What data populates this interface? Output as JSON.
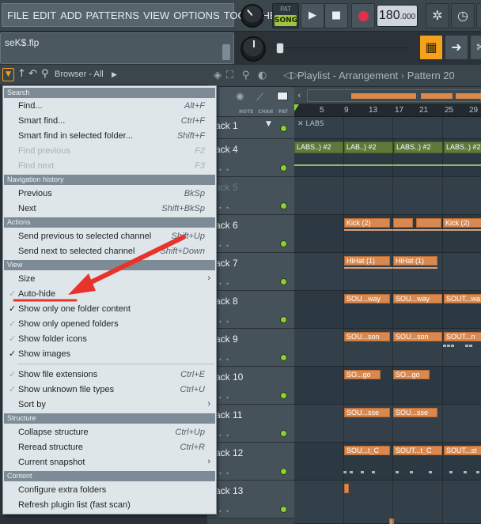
{
  "menubar": [
    "FILE",
    "EDIT",
    "ADD",
    "PATTERNS",
    "VIEW",
    "OPTIONS",
    "TOOLS",
    "HELP"
  ],
  "transport": {
    "pat_label": "PAT",
    "song_label": "SONG",
    "tempo_int": "180",
    "tempo_dec": ".000"
  },
  "hint": {
    "project": "seK$.flp"
  },
  "browser": {
    "title": "Browser - All"
  },
  "playlist": {
    "title": "Playlist - Arrangement",
    "pattern": "Pattern 20"
  },
  "tracklist": {
    "headers": [
      "NOTE",
      "CHAN",
      "PAT"
    ],
    "tracks": [
      "ack 1",
      "ack 4",
      "ack 5",
      "ack 6",
      "ack 7",
      "ack 8",
      "ack 9",
      "ack 10",
      "ack 11",
      "ack 12",
      "ack 13"
    ]
  },
  "ruler": [
    "5",
    "9",
    "13",
    "17",
    "21",
    "25",
    "29"
  ],
  "clips": {
    "labs_header": "LABS",
    "labs": [
      "LABS..) #2",
      "LAB..) #2",
      "LABS..) #2",
      "LABS..) #2"
    ],
    "kick": [
      "Kick (2)",
      "",
      "",
      "Kick (2)"
    ],
    "hihat": [
      "HiHat (1)",
      "HiHat (1)"
    ],
    "sou_way": [
      "SOU...way",
      "SOU...way",
      "SOUT...wa"
    ],
    "sou_son": [
      "SOU...son",
      "SOU...son",
      "SOUT...n"
    ],
    "so_go": [
      "SO...go",
      "SO...go"
    ],
    "sou_sse": [
      "SOU...sse",
      "SOU...sse"
    ],
    "sou_tc": [
      "SOU...t_C",
      "SOUT...t_C",
      "SOUT...st"
    ]
  },
  "menu": {
    "sections": {
      "search": "Search",
      "nav": "Navigation history",
      "actions": "Actions",
      "view": "View",
      "structure": "Structure",
      "content": "Content"
    },
    "search": [
      {
        "label": "Find...",
        "shortcut": "Alt+F"
      },
      {
        "label": "Smart find...",
        "shortcut": "Ctrl+F"
      },
      {
        "label": "Smart find in selected folder...",
        "shortcut": "Shift+F"
      },
      {
        "label": "Find previous",
        "shortcut": "F2"
      },
      {
        "label": "Find next",
        "shortcut": "F3"
      }
    ],
    "nav": [
      {
        "label": "Previous",
        "shortcut": "BkSp"
      },
      {
        "label": "Next",
        "shortcut": "Shift+BkSp"
      }
    ],
    "actions": [
      {
        "label": "Send previous to selected channel",
        "shortcut": "Shift+Up"
      },
      {
        "label": "Send next to selected channel",
        "shortcut": "Shift+Down"
      }
    ],
    "view": [
      {
        "label": "Size",
        "shortcut": ""
      },
      {
        "label": "Auto-hide",
        "shortcut": ""
      },
      {
        "label": "Show only one folder content",
        "shortcut": ""
      },
      {
        "label": "Show only opened folders",
        "shortcut": ""
      },
      {
        "label": "Show folder icons",
        "shortcut": ""
      },
      {
        "label": "Show images",
        "shortcut": ""
      },
      {
        "label": "Show file extensions",
        "shortcut": "Ctrl+E"
      },
      {
        "label": "Show unknown file types",
        "shortcut": "Ctrl+U"
      },
      {
        "label": "Sort by",
        "shortcut": ""
      }
    ],
    "structure": [
      {
        "label": "Collapse structure",
        "shortcut": "Ctrl+Up"
      },
      {
        "label": "Reread structure",
        "shortcut": "Ctrl+R"
      },
      {
        "label": "Current snapshot",
        "shortcut": ""
      }
    ],
    "content": [
      {
        "label": "Configure extra folders",
        "shortcut": ""
      },
      {
        "label": "Refresh plugin list (fast scan)",
        "shortcut": ""
      }
    ]
  },
  "colors": {
    "accent": "#f4a11c",
    "song_green": "#9cc73a",
    "clip_orange": "#d9894f",
    "annotation_red": "#e8332d"
  }
}
